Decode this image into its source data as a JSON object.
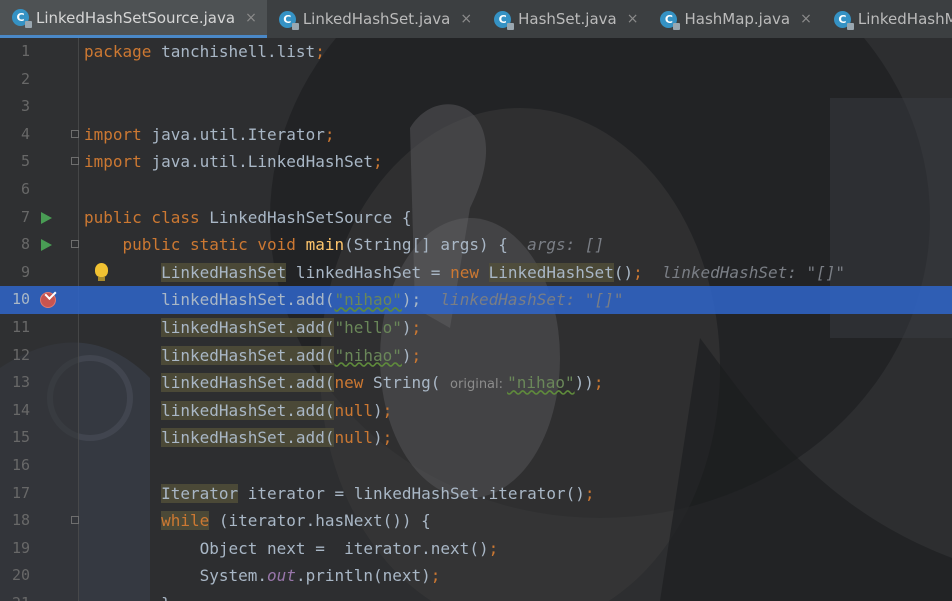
{
  "tabs": [
    {
      "label": "LinkedHashSetSource.java",
      "active": true,
      "icon": "class-icon",
      "closable": true
    },
    {
      "label": "LinkedHashSet.java",
      "active": false,
      "icon": "class-icon",
      "closable": true
    },
    {
      "label": "HashSet.java",
      "active": false,
      "icon": "class-icon",
      "closable": true
    },
    {
      "label": "HashMap.java",
      "active": false,
      "icon": "class-icon",
      "closable": true
    },
    {
      "label": "LinkedHashMap.java",
      "active": false,
      "icon": "class-icon",
      "closable": false
    }
  ],
  "tab_close_glyph": "×",
  "colors": {
    "keyword": "#cc7832",
    "string": "#6a8759",
    "method": "#ffc66d",
    "static_field": "#9876aa",
    "execution_line": "#2f65ca",
    "breakpoint": "#c75450"
  },
  "editor": {
    "lines": [
      {
        "number": "1",
        "parts": [
          {
            "t": "package ",
            "c": "kw"
          },
          {
            "t": "tanchishell.list"
          },
          {
            "t": ";",
            "c": "kw"
          }
        ]
      },
      {
        "number": "2",
        "parts": []
      },
      {
        "number": "3",
        "parts": []
      },
      {
        "number": "4",
        "fold": true,
        "parts": [
          {
            "t": "import ",
            "c": "kw"
          },
          {
            "t": "java.util.Iterator"
          },
          {
            "t": ";",
            "c": "kw"
          }
        ]
      },
      {
        "number": "5",
        "fold": true,
        "parts": [
          {
            "t": "import ",
            "c": "kw"
          },
          {
            "t": "java.util.LinkedHashSet"
          },
          {
            "t": ";",
            "c": "kw"
          }
        ]
      },
      {
        "number": "6",
        "parts": []
      },
      {
        "number": "7",
        "run": true,
        "parts": [
          {
            "t": "public class ",
            "c": "kw"
          },
          {
            "t": "LinkedHashSetSource {"
          }
        ]
      },
      {
        "number": "8",
        "run": true,
        "fold": true,
        "parts": [
          {
            "t": "    "
          },
          {
            "t": "public static void ",
            "c": "kw"
          },
          {
            "t": "main",
            "c": "fn"
          },
          {
            "t": "(String[] args) {  "
          },
          {
            "t": "args: []",
            "c": "hint"
          }
        ]
      },
      {
        "number": "9",
        "bulb": true,
        "parts": [
          {
            "t": "        "
          },
          {
            "t": "LinkedHashSet",
            "c": "hl"
          },
          {
            "t": " linkedHashSet = "
          },
          {
            "t": "new ",
            "c": "kw"
          },
          {
            "t": "LinkedHashSet",
            "c": "hl"
          },
          {
            "t": "()"
          },
          {
            "t": ";",
            "c": "kw"
          },
          {
            "t": "  "
          },
          {
            "t": "linkedHashSet: \"[]\"",
            "c": "hint"
          }
        ]
      },
      {
        "number": "10",
        "exec": true,
        "breakpoint": true,
        "parts": [
          {
            "t": "        linkedHashSet.add("
          },
          {
            "t": "\"nihao\"",
            "c": "str-typo"
          },
          {
            "t": ");  "
          },
          {
            "t": "linkedHashSet: \"[]\"",
            "c": "hint"
          }
        ]
      },
      {
        "number": "11",
        "parts": [
          {
            "t": "        "
          },
          {
            "t": "linkedHashSet.add(",
            "c": "hl"
          },
          {
            "t": "\"hello\"",
            "c": "str"
          },
          {
            "t": ")"
          },
          {
            "t": ";",
            "c": "kw"
          }
        ]
      },
      {
        "number": "12",
        "parts": [
          {
            "t": "        "
          },
          {
            "t": "linkedHashSet.add(",
            "c": "hl"
          },
          {
            "t": "\"nihao\"",
            "c": "str-typo"
          },
          {
            "t": ")"
          },
          {
            "t": ";",
            "c": "kw"
          }
        ]
      },
      {
        "number": "13",
        "parts": [
          {
            "t": "        "
          },
          {
            "t": "linkedHashSet.add(",
            "c": "hl"
          },
          {
            "t": "new ",
            "c": "kw"
          },
          {
            "t": "String( "
          },
          {
            "t": "original: ",
            "c": "phint"
          },
          {
            "t": "\"nihao\"",
            "c": "str-typo"
          },
          {
            "t": "))"
          },
          {
            "t": ";",
            "c": "kw"
          }
        ]
      },
      {
        "number": "14",
        "parts": [
          {
            "t": "        "
          },
          {
            "t": "linkedHashSet.add(",
            "c": "hl"
          },
          {
            "t": "null",
            "c": "kw"
          },
          {
            "t": ")"
          },
          {
            "t": ";",
            "c": "kw"
          }
        ]
      },
      {
        "number": "15",
        "parts": [
          {
            "t": "        "
          },
          {
            "t": "linkedHashSet.add(",
            "c": "hl"
          },
          {
            "t": "null",
            "c": "kw"
          },
          {
            "t": ")"
          },
          {
            "t": ";",
            "c": "kw"
          }
        ]
      },
      {
        "number": "16",
        "parts": []
      },
      {
        "number": "17",
        "parts": [
          {
            "t": "        "
          },
          {
            "t": "Iterator",
            "c": "hl"
          },
          {
            "t": " iterator = linkedHashSet.iterator()"
          },
          {
            "t": ";",
            "c": "kw"
          }
        ]
      },
      {
        "number": "18",
        "fold": true,
        "parts": [
          {
            "t": "        "
          },
          {
            "t": "while",
            "c": "kw-hl"
          },
          {
            "t": " (iterator.hasNext()) {"
          }
        ]
      },
      {
        "number": "19",
        "parts": [
          {
            "t": "            Object next =  iterator.next()"
          },
          {
            "t": ";",
            "c": "kw"
          }
        ]
      },
      {
        "number": "20",
        "parts": [
          {
            "t": "            System."
          },
          {
            "t": "out",
            "c": "italic-field"
          },
          {
            "t": ".println(next)"
          },
          {
            "t": ";",
            "c": "kw"
          }
        ]
      },
      {
        "number": "21",
        "parts": [
          {
            "t": "        }"
          }
        ]
      }
    ]
  }
}
